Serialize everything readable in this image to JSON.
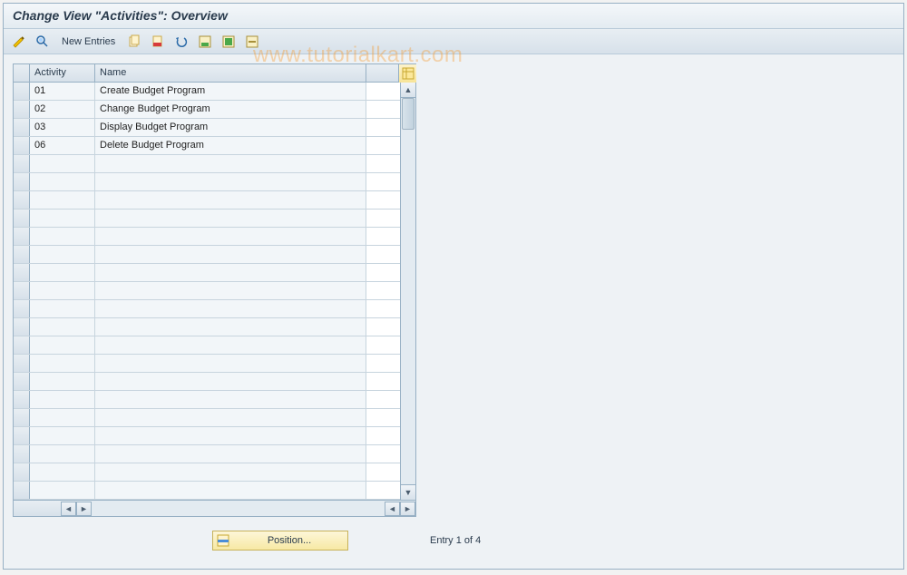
{
  "title": "Change View \"Activities\": Overview",
  "toolbar": {
    "new_entries": "New Entries"
  },
  "watermark": "www.tutorialkart.com",
  "table": {
    "columns": {
      "activity": "Activity",
      "name": "Name"
    },
    "rows": [
      {
        "activity": "01",
        "name": "Create Budget Program"
      },
      {
        "activity": "02",
        "name": "Change Budget Program"
      },
      {
        "activity": "03",
        "name": "Display Budget Program"
      },
      {
        "activity": "06",
        "name": "Delete Budget Program"
      }
    ],
    "empty_row_count": 19
  },
  "footer": {
    "position_button": "Position...",
    "entry_status": "Entry 1 of 4"
  }
}
